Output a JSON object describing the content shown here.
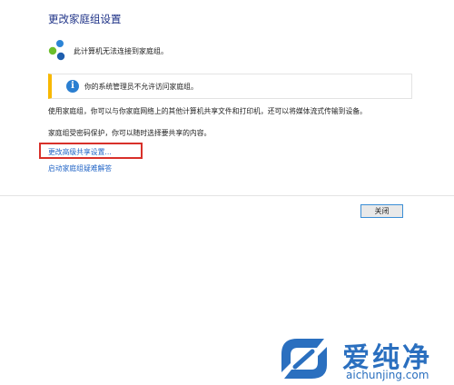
{
  "page": {
    "title": "更改家庭组设置"
  },
  "status": {
    "icon": "homegroup-icon",
    "text": "此计算机无法连接到家庭组。"
  },
  "info": {
    "icon": "info-icon",
    "glyph": "i",
    "text": "你的系统管理员不允许访问家庭组。",
    "accent": "#f8b800"
  },
  "body": {
    "para1": "使用家庭组，你可以与你家庭网络上的其他计算机共享文件和打印机，还可以将媒体流式传输到设备。",
    "para2": "家庭组受密码保护，你可以随时选择要共享的内容。"
  },
  "links": {
    "advanced_sharing": "更改高级共享设置...",
    "troubleshooter": "启动家庭组疑难解答"
  },
  "footer": {
    "close_label": "关闭"
  },
  "watermark": {
    "logo": "aichunjing-logo",
    "brand": "爱纯净",
    "url": "aichunjing.com"
  },
  "colors": {
    "title": "#1e3287",
    "link": "#1f63c6",
    "highlight": "#d8302a",
    "brand": "#2a6fbf"
  }
}
